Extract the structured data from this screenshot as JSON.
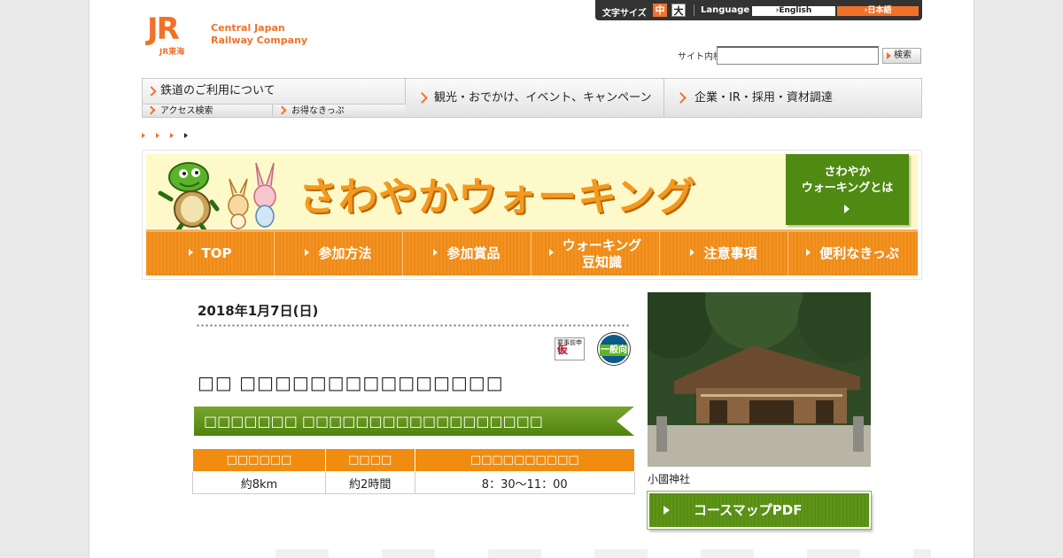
{
  "header": {
    "logo_mark": "JR",
    "logo_sub": "JR東海",
    "logo_line1": "Central Japan",
    "logo_line2": "Railway Company"
  },
  "toolbar": {
    "font_size_label": "文字サイズ",
    "size_medium": "中",
    "size_large": "大",
    "language_label": "Language",
    "lang_english": "›English",
    "lang_japanese": "›日本語"
  },
  "search": {
    "label": "サイト内検索",
    "value": "",
    "button": "検索"
  },
  "global_nav": {
    "rail": "鉄道のご利用について",
    "access": "アクセス検索",
    "tickets": "お得なきっぷ",
    "kanko": "観光・おでかけ、イベント、キャンペーン",
    "corp": "企業・IR・採用・資材調達"
  },
  "walking": {
    "title": "さわやかウォーキング",
    "about_line1": "さわやか",
    "about_line2": "ウォーキングとは",
    "nav": [
      {
        "label": "TOP"
      },
      {
        "label": "参加方法"
      },
      {
        "label": "参加賞品"
      },
      {
        "label1": "ウォーキング",
        "label2": "豆知識"
      },
      {
        "label": "注意事項"
      },
      {
        "label": "便利なきっぷ"
      }
    ]
  },
  "event": {
    "date": "2018年1月7日(日)",
    "badge_kari_top": "要事前申込",
    "badge_kari": "仮",
    "badge_ippan": "一般向",
    "course_title": "□□ □□□□□□□□□□□□□□□",
    "subtitle": "□□□□□□□ □□□□□□□□□□□□□□□□□□",
    "table": {
      "headers": [
        "□□□□□□",
        "□□□□",
        "□□□□□□□□□□"
      ],
      "values": [
        "約8km",
        "約2時間",
        "8：30〜11：00"
      ]
    },
    "photo_caption": "小國神社",
    "pdf_button": "コースマップPDF"
  },
  "colors": {
    "jr_orange": "#f0722a",
    "walk_orange": "#ee8a18",
    "walk_green": "#4f8a12",
    "banner_bg": "#fef9c8"
  }
}
